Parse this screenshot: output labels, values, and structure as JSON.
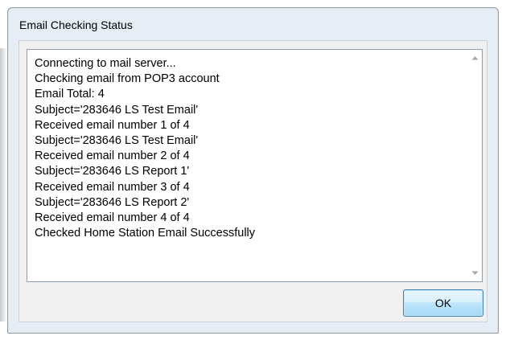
{
  "window": {
    "title": "Email Checking Status"
  },
  "log": {
    "lines": [
      "Connecting to mail server...",
      "Checking email from POP3 account",
      "Email Total: 4",
      "Subject='283646 LS Test Email'",
      "Received email number 1 of 4",
      "Subject='283646 LS Test Email'",
      "Received email number 2 of 4",
      "Subject='283646 LS Report 1'",
      "Received email number 3 of 4",
      "Subject='283646 LS Report 2'",
      "Received email number 4 of 4",
      "Checked Home Station Email Successfully"
    ]
  },
  "scrollbar": {
    "up_icon": "chevron-up-icon",
    "down_icon": "chevron-down-icon"
  },
  "buttons": {
    "ok_label": "OK"
  },
  "colors": {
    "dialog_frame": "#e6edf5",
    "button_border": "#3c7fb1",
    "client_background": "#f0f0f0"
  }
}
